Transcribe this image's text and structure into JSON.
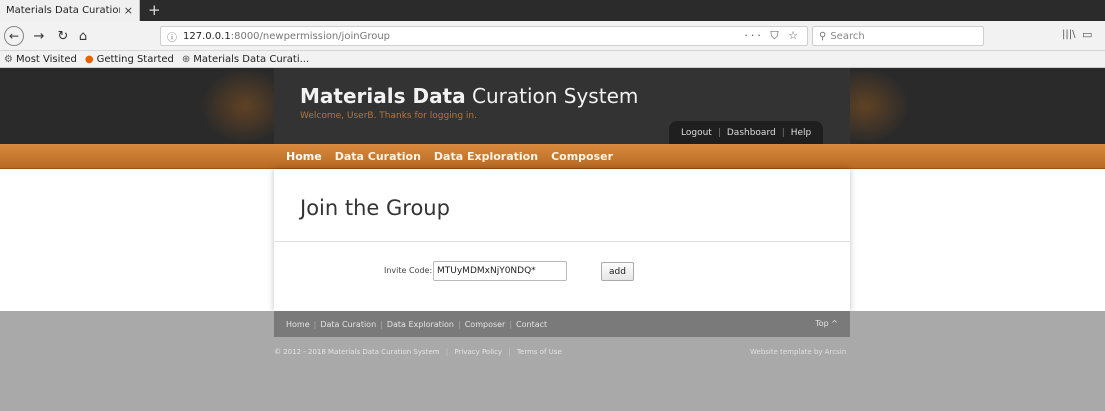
{
  "browser": {
    "tab_title": "Materials Data Curation Sy",
    "tab_close": "×",
    "new_tab": "+",
    "url_host": "127.0.0.1",
    "url_path": ":8000/newpermission/joinGroup",
    "url_actions": "··· ⛉ ☆",
    "search_placeholder": "Search",
    "bookmarks": [
      {
        "label": "Most Visited",
        "icon": "gear-icon"
      },
      {
        "label": "Getting Started",
        "icon": "firefox-icon"
      },
      {
        "label": "Materials Data Curati...",
        "icon": "globe-icon"
      }
    ]
  },
  "site": {
    "title_bold": "Materials Data",
    "title_rest": " Curation System",
    "welcome": "Welcome, UserB. Thanks for logging in.",
    "top_links": {
      "logout": "Logout",
      "dashboard": "Dashboard",
      "help": "Help"
    },
    "menu": [
      "Home",
      "Data Curation",
      "Data Exploration",
      "Composer"
    ],
    "active_menu": "Home"
  },
  "content": {
    "title": "Join the Group",
    "invite_label": "Invite Code:",
    "invite_value": "MTUyMDMxNjY0NDQ*",
    "add_label": "add"
  },
  "footer": {
    "links": [
      "Home",
      "Data Curation",
      "Data Exploration",
      "Composer",
      "Contact"
    ],
    "top": "Top ^",
    "copyright": "© 2012 - 2018 Materials Data Curation System",
    "privacy": "Privacy Policy",
    "terms": "Terms of Use",
    "credit": "Website template by Arcsin"
  },
  "colors": {
    "accent_orange": "#c97a30",
    "header_dark": "#2a2a2a",
    "welcome_text": "#b5773a"
  }
}
